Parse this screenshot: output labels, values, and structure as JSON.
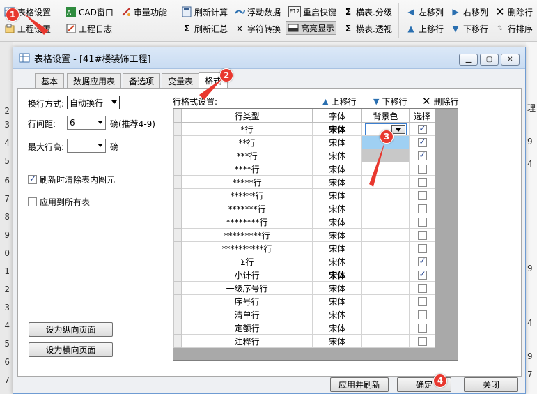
{
  "ribbon": {
    "items": [
      {
        "id": "table-settings",
        "label": "表格设置",
        "icon": "table-icon"
      },
      {
        "id": "project-settings",
        "label": "工程设置",
        "icon": "project-icon"
      },
      {
        "id": "cad-window",
        "label": "CAD窗口",
        "icon": "cad-icon"
      },
      {
        "id": "project-log",
        "label": "工程日志",
        "icon": "log-icon"
      },
      {
        "id": "audit",
        "label": "审量功能",
        "icon": "audit-icon"
      },
      {
        "id": "refresh-calc",
        "label": "刷新计算",
        "icon": "calc-icon"
      },
      {
        "id": "refresh-sum",
        "label": "刷新汇总",
        "icon": "sigma-icon"
      },
      {
        "id": "float-data",
        "label": "浮动数据",
        "icon": "float-icon"
      },
      {
        "id": "char-convert",
        "label": "字符转换",
        "icon": "x-icon"
      },
      {
        "id": "reset-shortcut",
        "label": "重启快键",
        "icon": "f12-icon"
      },
      {
        "id": "highlight",
        "label": "高亮显示",
        "icon": "highlight-icon"
      },
      {
        "id": "table-level",
        "label": "横表.分级",
        "icon": "sigma-icon"
      },
      {
        "id": "table-pivot",
        "label": "横表.透视",
        "icon": "sigma-icon"
      },
      {
        "id": "move-left",
        "label": "左移列",
        "icon": "left-arrow-icon"
      },
      {
        "id": "move-up-row",
        "label": "上移行",
        "icon": "up-arrow-icon"
      },
      {
        "id": "move-right",
        "label": "右移列",
        "icon": "right-arrow-icon"
      },
      {
        "id": "move-down-row",
        "label": "下移行",
        "icon": "down-arrow-icon"
      },
      {
        "id": "delete-col",
        "label": "删除行",
        "icon": "x-icon"
      },
      {
        "id": "sort-row",
        "label": "行排序",
        "icon": "sort-icon"
      }
    ],
    "f12_text": "F12"
  },
  "dialog": {
    "title": "表格设置 - [41#楼装饰工程]",
    "tabs": [
      "基本",
      "数据应用表",
      "备选项",
      "变量表",
      "格式"
    ],
    "active_tab": "格式"
  },
  "form": {
    "wrap_label": "换行方式:",
    "wrap_value": "自动换行",
    "spacing_label": "行间距:",
    "spacing_value": "6",
    "spacing_unit": "磅(推荐4-9)",
    "max_height_label": "最大行高:",
    "max_height_value": "",
    "max_height_unit": "磅",
    "clear_on_refresh": {
      "label": "刷新时清除表内图元",
      "checked": true
    },
    "apply_all": {
      "label": "应用到所有表",
      "checked": false
    },
    "portrait_button": "设为纵向页面",
    "landscape_button": "设为横向页面"
  },
  "grid_toolbar": {
    "title": "行格式设置:",
    "up": "上移行",
    "down": "下移行",
    "delete": "删除行"
  },
  "grid": {
    "headers": [
      "行类型",
      "字体",
      "背景色",
      "选择"
    ],
    "rows": [
      {
        "type": "*行",
        "font": "宋体",
        "bold": true,
        "bg": "#ffffff",
        "selected": true,
        "editing": true
      },
      {
        "type": "**行",
        "font": "宋体",
        "bold": false,
        "bg": "#9fd0f3",
        "selected": true
      },
      {
        "type": "***行",
        "font": "宋体",
        "bold": false,
        "bg": "#c8c8c8",
        "selected": true
      },
      {
        "type": "****行",
        "font": "宋体",
        "bold": false,
        "bg": "",
        "selected": false
      },
      {
        "type": "*****行",
        "font": "宋体",
        "bold": false,
        "bg": "",
        "selected": false
      },
      {
        "type": "******行",
        "font": "宋体",
        "bold": false,
        "bg": "",
        "selected": false
      },
      {
        "type": "*******行",
        "font": "宋体",
        "bold": false,
        "bg": "",
        "selected": false
      },
      {
        "type": "********行",
        "font": "宋体",
        "bold": false,
        "bg": "",
        "selected": false
      },
      {
        "type": "*********行",
        "font": "宋体",
        "bold": false,
        "bg": "",
        "selected": false
      },
      {
        "type": "**********行",
        "font": "宋体",
        "bold": false,
        "bg": "",
        "selected": false
      },
      {
        "type": "Σ行",
        "font": "宋体",
        "bold": false,
        "bg": "",
        "selected": true
      },
      {
        "type": "小计行",
        "font": "宋体",
        "bold": true,
        "bg": "",
        "selected": true
      },
      {
        "type": "一级序号行",
        "font": "宋体",
        "bold": false,
        "bg": "",
        "selected": false
      },
      {
        "type": "序号行",
        "font": "宋体",
        "bold": false,
        "bg": "",
        "selected": false
      },
      {
        "type": "清单行",
        "font": "宋体",
        "bold": false,
        "bg": "",
        "selected": false
      },
      {
        "type": "定额行",
        "font": "宋体",
        "bold": false,
        "bg": "",
        "selected": false
      },
      {
        "type": "注释行",
        "font": "宋体",
        "bold": false,
        "bg": "",
        "selected": false
      }
    ]
  },
  "footer": {
    "apply_refresh": "应用并刷新",
    "ok": "确定",
    "close": "关闭"
  },
  "annotations": [
    "1",
    "2",
    "3",
    "4"
  ],
  "background": {
    "left_numbers": [
      "2",
      "3",
      "4",
      "5",
      "6",
      "7",
      "8",
      "9",
      "0",
      "1",
      "2",
      "3",
      "4",
      "5",
      "6",
      "7"
    ],
    "right_fragments": [
      "理",
      "9",
      "4",
      "9",
      "4",
      "9",
      "7"
    ]
  },
  "colors": {
    "annotation_red": "#e8382f",
    "row_bg_light_blue": "#9fd0f3",
    "row_bg_gray": "#c8c8c8",
    "dialog_border": "#6f9cd3"
  }
}
